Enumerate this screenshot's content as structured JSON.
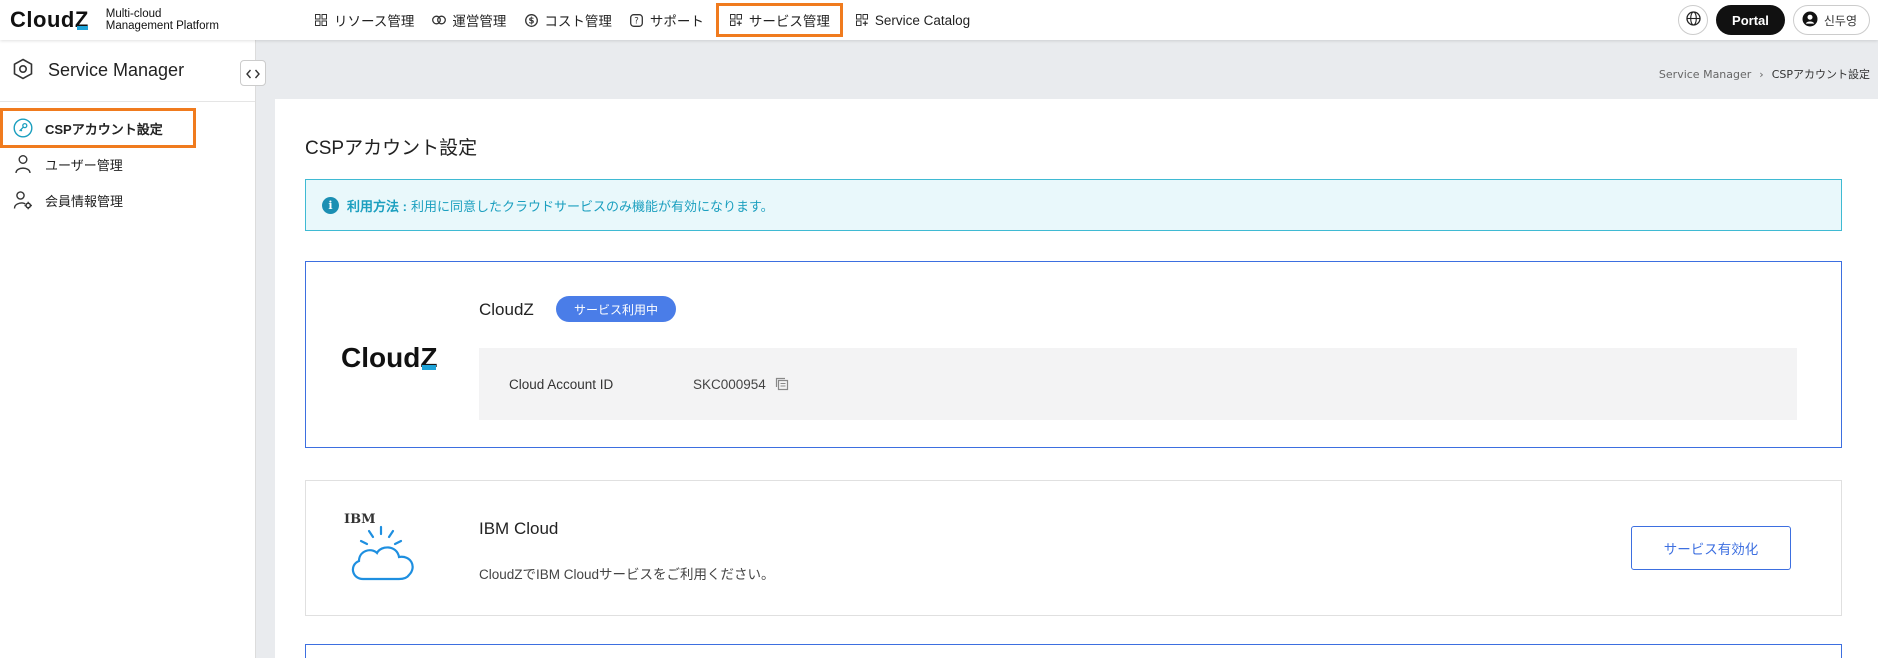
{
  "header": {
    "logo_text": "Cloud",
    "logo_z": "Z",
    "subtitle_line1": "Multi-cloud",
    "subtitle_line2": "Management Platform",
    "nav": [
      {
        "label": "リソース管理",
        "icon": "grid-icon"
      },
      {
        "label": "運営管理",
        "icon": "link-icon"
      },
      {
        "label": "コスト管理",
        "icon": "dollar-icon"
      },
      {
        "label": "サポート",
        "icon": "help-icon"
      },
      {
        "label": "サービス管理",
        "icon": "grid-plus-icon",
        "highlighted": true
      },
      {
        "label": "Service Catalog",
        "icon": "grid-plus-icon"
      }
    ],
    "portal_label": "Portal",
    "user_name": "신두영"
  },
  "sidebar": {
    "title": "Service Manager",
    "items": [
      {
        "label": "CSPアカウント設定",
        "icon": "key-icon",
        "active": true
      },
      {
        "label": "ユーザー管理",
        "icon": "user-icon"
      },
      {
        "label": "会員情報管理",
        "icon": "user-gear-icon"
      }
    ]
  },
  "breadcrumb": {
    "root": "Service Manager",
    "separator": "›",
    "current": "CSPアカウント設定"
  },
  "main": {
    "title": "CSPアカウント設定",
    "info_label": "利用方法 :",
    "info_text": "利用に同意したクラウドサービスのみ機能が有効になります。",
    "services": [
      {
        "name": "CloudZ",
        "logo_text": "Cloud",
        "logo_z": "Z",
        "status": "サービス利用中",
        "account_label": "Cloud Account ID",
        "account_id": "SKC000954"
      },
      {
        "name": "IBM Cloud",
        "logo_text": "IBM",
        "description": "CloudZでIBM Cloudサービスをご利用ください。",
        "button": "サービス有効化"
      }
    ]
  },
  "colors": {
    "accent": "#3d6fe0",
    "highlight": "#f07b1e",
    "info": "#1b9fbf",
    "brand_z": "#1ea3d8"
  }
}
